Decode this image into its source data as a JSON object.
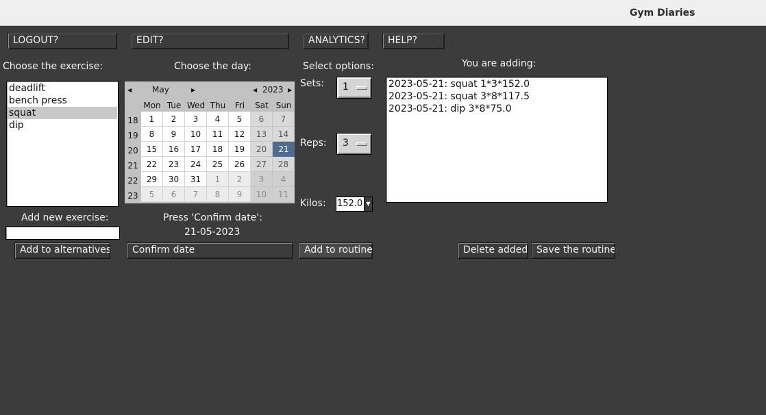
{
  "window": {
    "title": "Gym Diaries"
  },
  "menu": {
    "logout": "LOGOUT?",
    "edit": "EDIT?",
    "analytics": "ANALYTICS?",
    "help": "HELP?"
  },
  "exercise": {
    "label": "Choose the exercise:",
    "items": [
      "deadlift",
      "bench press",
      "squat",
      "dip"
    ],
    "selected": "squat",
    "new_label": "Add new exercise:",
    "new_value": "",
    "add_button": "Add to alternatives"
  },
  "day": {
    "label": "Choose the day:",
    "month": "May",
    "year": "2023",
    "weekdays": [
      "Mon",
      "Tue",
      "Wed",
      "Thu",
      "Fri",
      "Sat",
      "Sun"
    ],
    "weeks": [
      {
        "num": "18",
        "days": [
          "1",
          "2",
          "3",
          "4",
          "5",
          "6",
          "7"
        ]
      },
      {
        "num": "19",
        "days": [
          "8",
          "9",
          "10",
          "11",
          "12",
          "13",
          "14"
        ]
      },
      {
        "num": "20",
        "days": [
          "15",
          "16",
          "17",
          "18",
          "19",
          "20",
          "21"
        ]
      },
      {
        "num": "21",
        "days": [
          "22",
          "23",
          "24",
          "25",
          "26",
          "27",
          "28"
        ]
      },
      {
        "num": "22",
        "days": [
          "29",
          "30",
          "31",
          "1",
          "2",
          "3",
          "4"
        ]
      },
      {
        "num": "23",
        "days": [
          "5",
          "6",
          "7",
          "8",
          "9",
          "10",
          "11"
        ]
      }
    ],
    "selected_day": "21",
    "press_label": "Press 'Confirm date':",
    "confirmed_date": "21-05-2023",
    "confirm_button": "Confirm date"
  },
  "options": {
    "label": "Select options:",
    "sets_label": "Sets:",
    "sets_value": "1",
    "reps_label": "Reps:",
    "reps_value": "3",
    "kilos_label": "Kilos:",
    "kilos_value": "152.0",
    "add_button": "Add to routine"
  },
  "adding": {
    "label": "You are adding:",
    "items": [
      "2023-05-21: squat 1*3*152.0",
      "2023-05-21: squat 3*8*117.5",
      "2023-05-21: dip 3*8*75.0"
    ],
    "delete_button": "Delete added",
    "save_button": "Save the routine"
  },
  "icons": {
    "prev_month": "triangle-left-icon",
    "next_month": "triangle-right-icon",
    "prev_year": "triangle-left-icon",
    "next_year": "triangle-right-icon",
    "kilos_dropdown": "triangle-down-icon"
  },
  "colors": {
    "background": "#3c3c3c",
    "titlebar": "#efefef",
    "selected_day": "#4d6c8f",
    "list_selection": "#c8c8c8"
  }
}
